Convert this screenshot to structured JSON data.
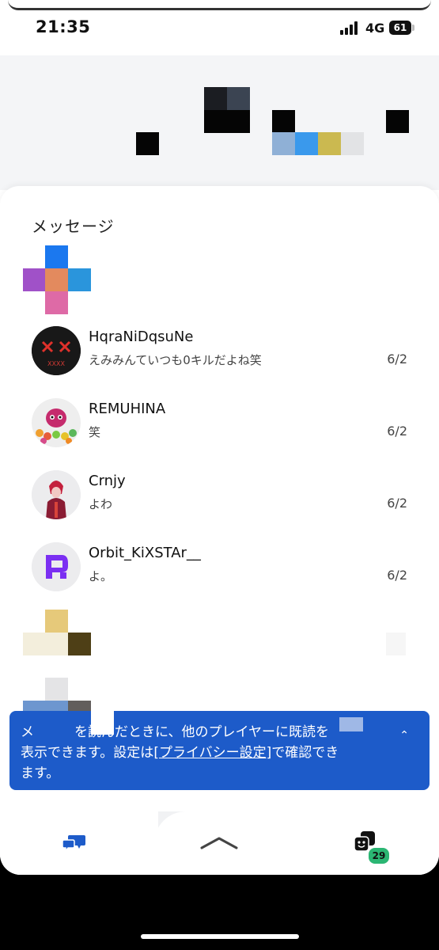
{
  "status_bar": {
    "time": "21:35",
    "network": "4G",
    "battery": "61"
  },
  "sheet": {
    "title": "メッセージ"
  },
  "messages": [
    {
      "name": "HqraNiDqsuNe",
      "preview": "えみみんていつも0キルだよね笑",
      "date": "6/2"
    },
    {
      "name": "REMUHINA",
      "preview": "笑",
      "date": "6/2"
    },
    {
      "name": "Crnjy",
      "preview": "よわ",
      "date": "6/2"
    },
    {
      "name": "Orbit_KiXSTAr__",
      "preview": "よ。",
      "date": "6/2"
    }
  ],
  "banner": {
    "text_line1": "メ　　　を読んだときに、他のプレイヤーに既読を",
    "text_line2a": "表示できます。設定は",
    "link": "[プライバシー設定]",
    "text_line2b": "で確認でき",
    "text_line3": "ます。"
  },
  "nav": {
    "friends_badge": "29"
  },
  "colors": {
    "accent": "#1d5bc9",
    "badge": "#2bb673"
  }
}
